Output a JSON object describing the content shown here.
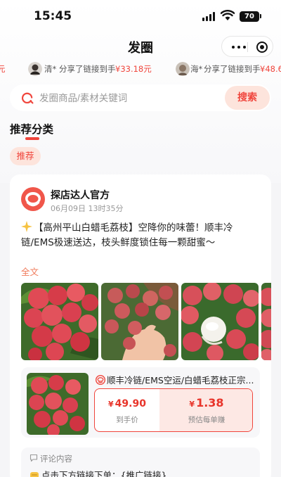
{
  "status_bar": {
    "time": "15:45",
    "battery": "70"
  },
  "nav": {
    "title": "发圈"
  },
  "ticker": {
    "items": [
      {
        "fragment": "元"
      },
      {
        "name": "清*",
        "action": "分享了链接到手",
        "amount": "¥33.18元"
      },
      {
        "name": "海*",
        "action": "分享了链接到手",
        "amount": "¥48.6"
      }
    ]
  },
  "search": {
    "placeholder": "发圈商品/素材关键词",
    "value": "",
    "button_label": "搜索"
  },
  "category": {
    "section_title": "推荐分类",
    "chips": [
      "推荐"
    ]
  },
  "post": {
    "account_name": "探店达人官方",
    "time": "06月09日 13时35分",
    "text": "【高州平山白蜡毛荔枝】空降你的味蕾！顺丰冷链/EMS极速送达，枝头鲜度锁住每一颗甜蜜～",
    "full_text_link": "全文",
    "photos": [
      "lychee-photo-1",
      "lychee-photo-2",
      "lychee-photo-3",
      "lychee-photo-4"
    ],
    "product": {
      "title": "顺丰冷链/EMS空运/白蜡毛荔枝正宗...",
      "price_currency": "¥",
      "price": "49.90",
      "price_label": "到手价",
      "earn_currency": "¥",
      "earn": "1.38",
      "earn_label": "预估每单赚"
    },
    "comment": {
      "header": "评论内容",
      "body": "点击下方链接下单：{推广链接}"
    }
  },
  "colors": {
    "accent": "#f0453c",
    "accent_light": "#fde4dc",
    "page_bg": "#f5f5f7"
  }
}
